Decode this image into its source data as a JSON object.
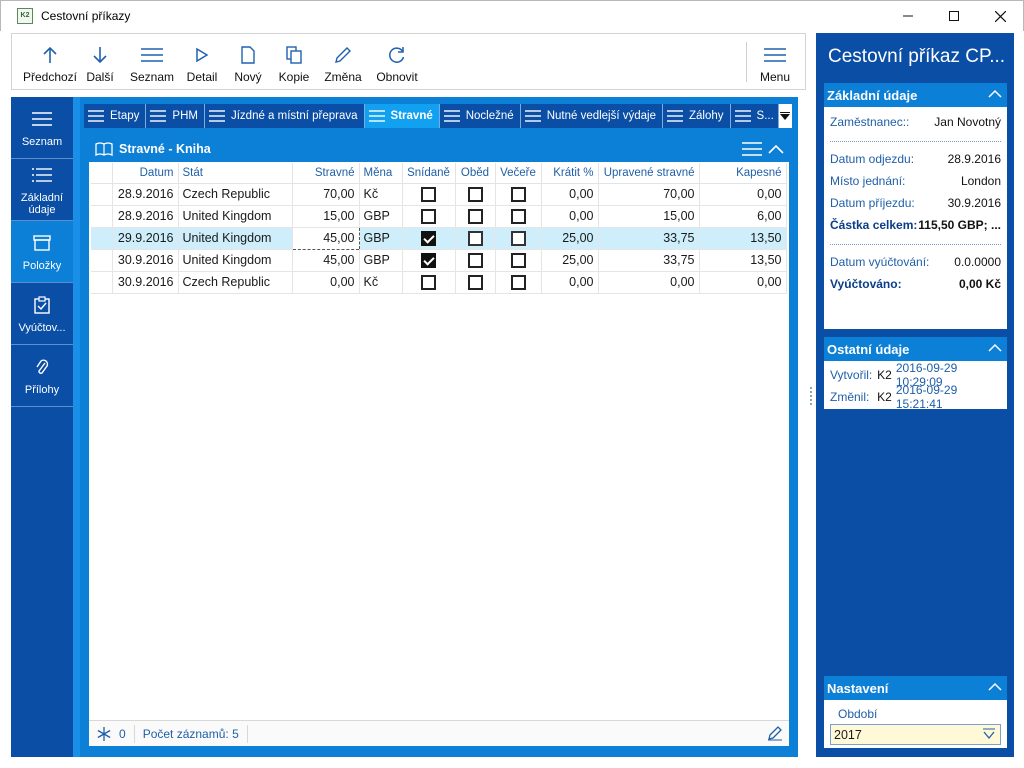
{
  "window": {
    "title": "Cestovní příkazy",
    "app_icon_text": "K2",
    "minimize": "—",
    "maximize": "☐",
    "close": "✕"
  },
  "toolbar": {
    "buttons": [
      {
        "label": "Předchozí",
        "icon": "arrow-up-icon"
      },
      {
        "label": "Další",
        "icon": "arrow-down-icon"
      },
      {
        "label": "Seznam",
        "icon": "list-icon"
      },
      {
        "label": "Detail",
        "icon": "play-icon"
      },
      {
        "label": "Nový",
        "icon": "new-document-icon"
      },
      {
        "label": "Kopie",
        "icon": "copy-icon"
      },
      {
        "label": "Změna",
        "icon": "pencil-icon"
      },
      {
        "label": "Obnovit",
        "icon": "refresh-icon"
      }
    ],
    "menu_label": "Menu"
  },
  "leftnav": {
    "items": [
      {
        "label": "Seznam",
        "icon": "list-icon",
        "active": false
      },
      {
        "label": "Základní údaje",
        "icon": "details-list-icon",
        "active": false
      },
      {
        "label": "Položky",
        "icon": "box-icon",
        "active": true
      },
      {
        "label": "Vyúčtov...",
        "icon": "clipboard-check-icon",
        "active": false
      },
      {
        "label": "Přílohy",
        "icon": "paperclip-icon",
        "active": false
      }
    ]
  },
  "tabs": [
    {
      "label": "Etapy",
      "active": false
    },
    {
      "label": "PHM",
      "active": false
    },
    {
      "label": "Jízdné a místní přeprava",
      "active": false
    },
    {
      "label": "Stravné",
      "active": true
    },
    {
      "label": "Nocležné",
      "active": false
    },
    {
      "label": "Nutné vedlejší výdaje",
      "active": false
    },
    {
      "label": "Zálohy",
      "active": false
    },
    {
      "label": "S...",
      "active": false
    }
  ],
  "panel": {
    "title": "Stravné - Kniha",
    "columns": [
      "Datum",
      "Stát",
      "Stravné",
      "Měna",
      "Snídaně",
      "Oběd",
      "Večeře",
      "Krátit %",
      "Upravené stravné",
      "Kapesné"
    ],
    "rows": [
      {
        "datum": "28.9.2016",
        "stat": "Czech Republic",
        "stravne": "70,00",
        "mena": "Kč",
        "snidane": false,
        "obed": false,
        "vecere": false,
        "kratit": "0,00",
        "upravene": "70,00",
        "kapesne": "0,00",
        "selected": false
      },
      {
        "datum": "28.9.2016",
        "stat": "United Kingdom",
        "stravne": "15,00",
        "mena": "GBP",
        "snidane": false,
        "obed": false,
        "vecere": false,
        "kratit": "0,00",
        "upravene": "15,00",
        "kapesne": "6,00",
        "selected": false
      },
      {
        "datum": "29.9.2016",
        "stat": "United Kingdom",
        "stravne": "45,00",
        "mena": "GBP",
        "snidane": true,
        "obed": false,
        "vecere": false,
        "kratit": "25,00",
        "upravene": "33,75",
        "kapesne": "13,50",
        "selected": true
      },
      {
        "datum": "30.9.2016",
        "stat": "United Kingdom",
        "stravne": "45,00",
        "mena": "GBP",
        "snidane": true,
        "obed": false,
        "vecere": false,
        "kratit": "25,00",
        "upravene": "33,75",
        "kapesne": "13,50",
        "selected": false
      },
      {
        "datum": "30.9.2016",
        "stat": "Czech Republic",
        "stravne": "0,00",
        "mena": "Kč",
        "snidane": false,
        "obed": false,
        "vecere": false,
        "kratit": "0,00",
        "upravene": "0,00",
        "kapesne": "0,00",
        "selected": false
      }
    ],
    "status": {
      "filter_count": "0",
      "record_count": "Počet záznamů: 5"
    }
  },
  "right": {
    "title": "Cestovní příkaz CP...",
    "basic": {
      "header": "Základní údaje",
      "employee_label": "Zaměstnanec::",
      "employee_value": "Jan Novotný",
      "departure_label": "Datum odjezdu:",
      "departure_value": "28.9.2016",
      "place_label": "Místo jednání:",
      "place_value": "London",
      "arrival_label": "Datum příjezdu:",
      "arrival_value": "30.9.2016",
      "total_label": "Částka celkem:",
      "total_value": "115,50 GBP; ...",
      "settlement_date_label": "Datum vyúčtování:",
      "settlement_date_value": "0.0.0000",
      "settled_label": "Vyúčtováno:",
      "settled_value": "0,00 Kč"
    },
    "other": {
      "header": "Ostatní údaje",
      "created_label": "Vytvořil:",
      "created_user": "K2",
      "created_time": "2016-09-29 10:29:09",
      "changed_label": "Změnil:",
      "changed_user": "K2",
      "changed_time": "2016-09-29 15:21:41"
    },
    "settings": {
      "header": "Nastavení",
      "period_label": "Období",
      "period_value": "2017"
    }
  },
  "colors": {
    "nav_dark": "#0a4ea6",
    "accent": "#0c7fd6",
    "selected_row": "#cfeefb",
    "period_bg": "#fff9d8"
  }
}
